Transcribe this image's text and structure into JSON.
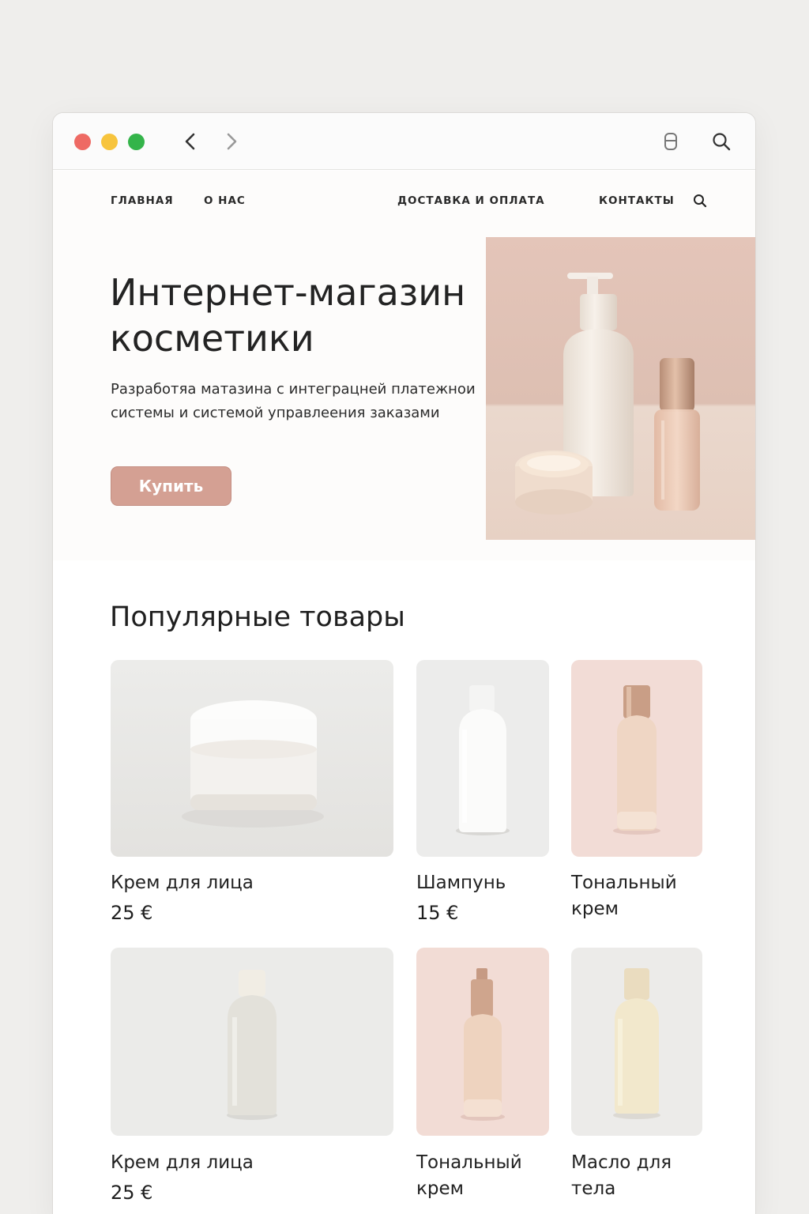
{
  "nav": {
    "home": "ГЛАВНАЯ",
    "about": "О НАС",
    "delivery": "ДОСТАВКА И ОПЛАТА",
    "contacts": "КОНТАКТЫ"
  },
  "hero": {
    "title": "Интернет-магазин косметики",
    "subtitle": "Разработяа матазина с интеграцней платежнои системы и системой управлеения заказами",
    "button": "Купить"
  },
  "section_title": "Популярные товары",
  "products": [
    {
      "name": "Крем для лица",
      "price": "25 €"
    },
    {
      "name": "Шампунь",
      "price": "15 €"
    },
    {
      "name": "Тональный крем",
      "price": ""
    },
    {
      "name": "Крем для лица",
      "price": "25 €"
    },
    {
      "name": "Тональный крем",
      "price": ""
    },
    {
      "name": "Масло для тела",
      "price": ""
    }
  ],
  "colors": {
    "accent": "#d4a093",
    "hero_image_bg": "#e6c9bd",
    "card_pink": "#f2dcd6",
    "card_grey": "#ececea"
  },
  "icons": {
    "back": "chevron-left-icon",
    "forward": "chevron-right-icon",
    "tabs": "tabs-icon",
    "search": "search-icon"
  }
}
